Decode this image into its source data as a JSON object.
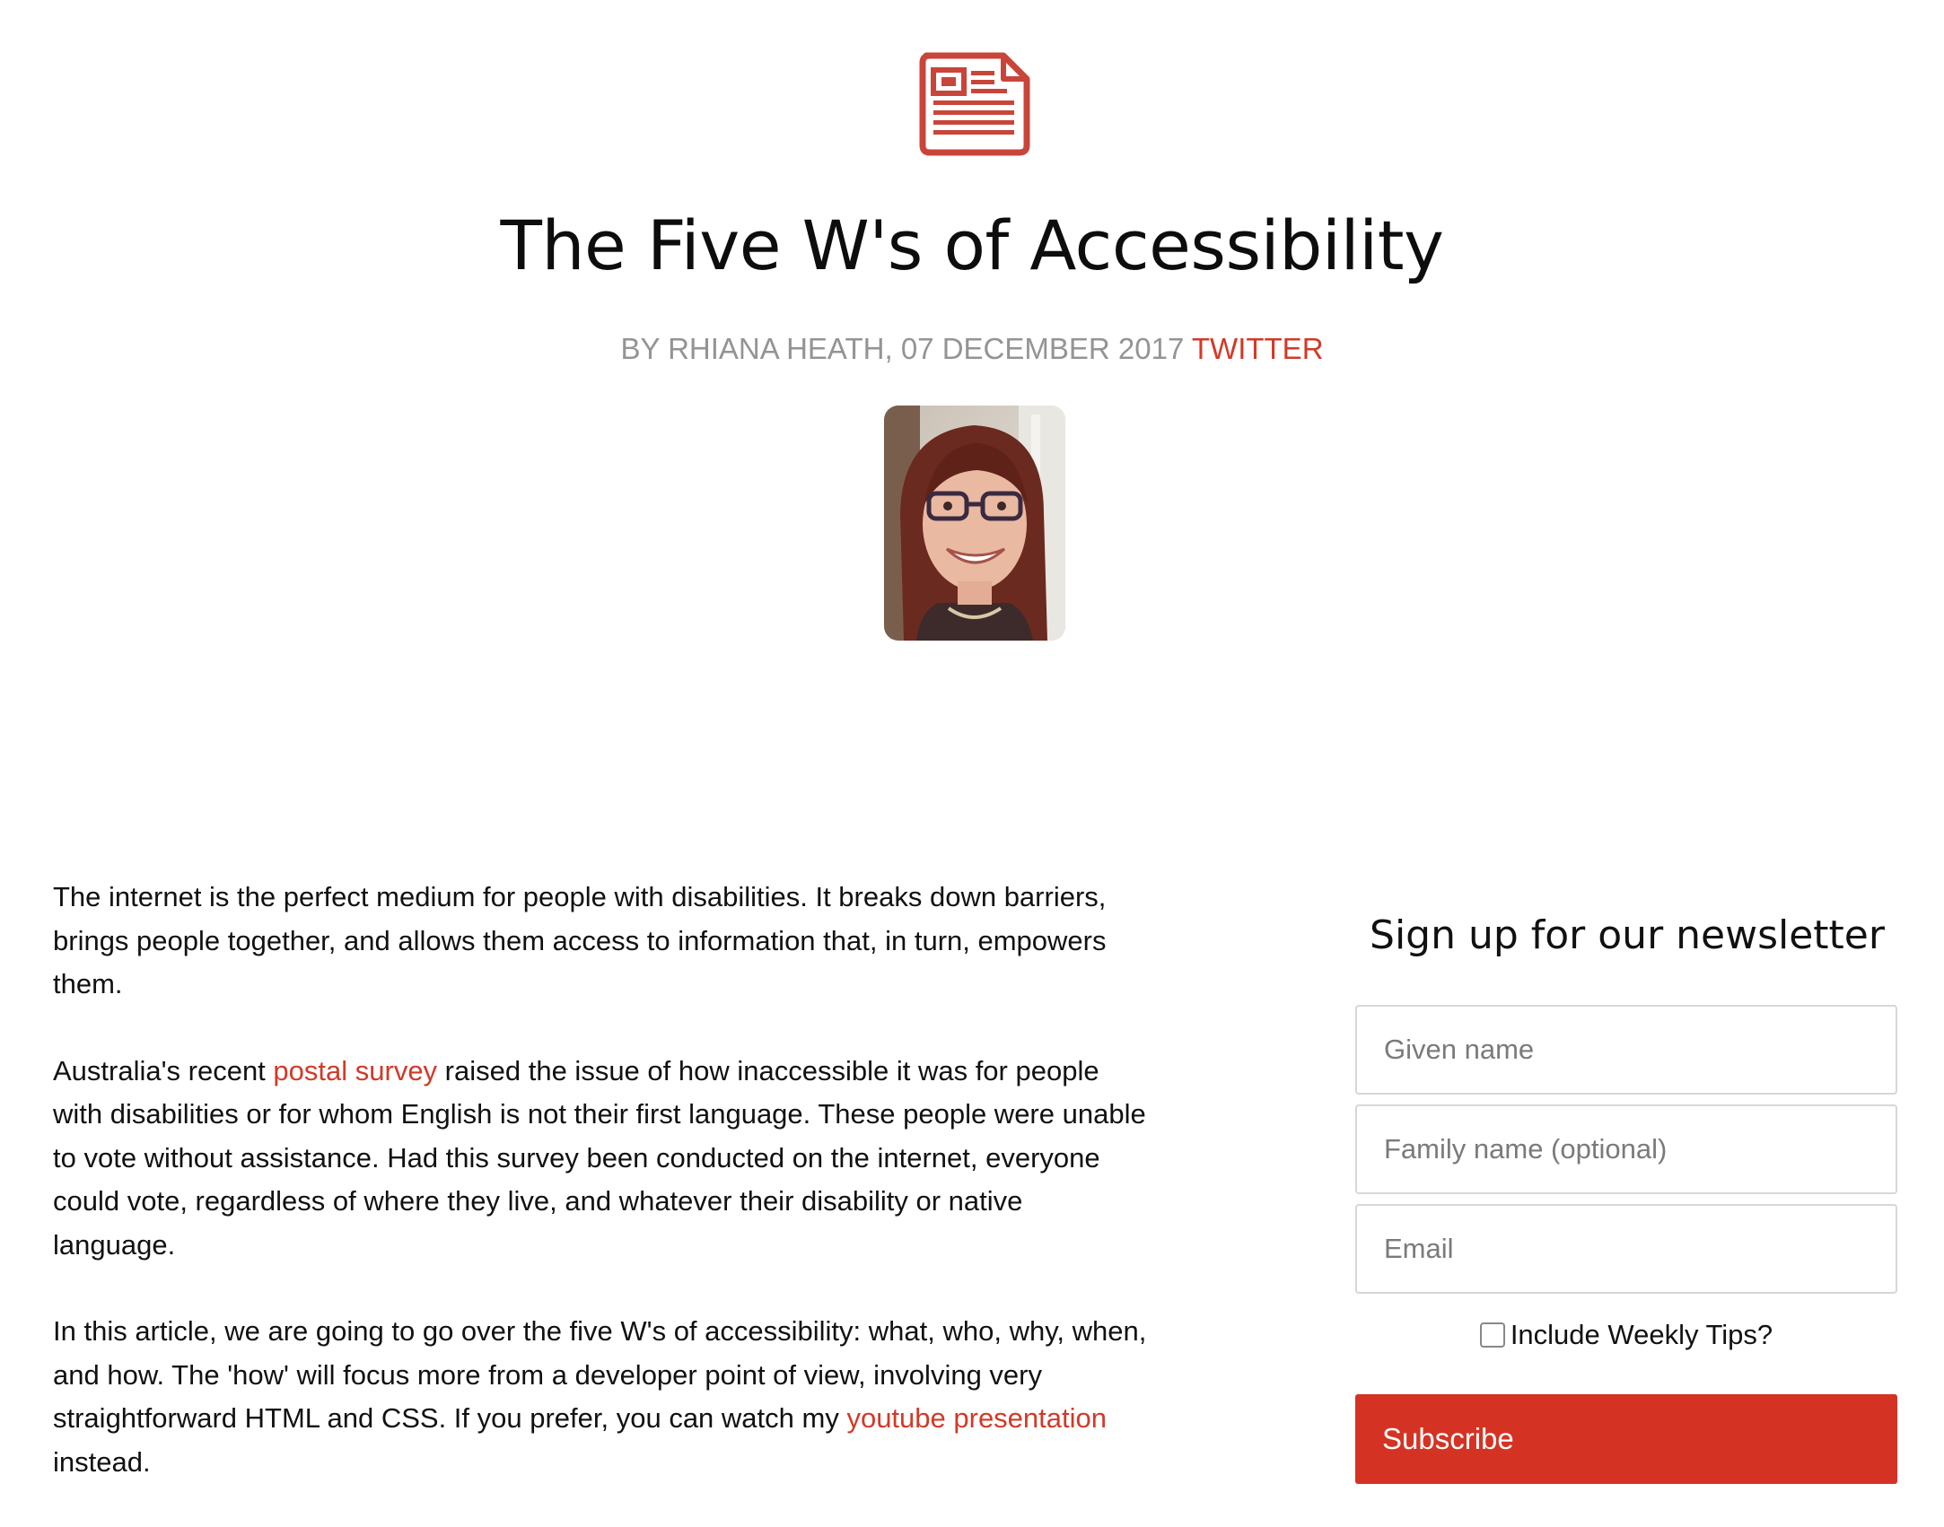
{
  "header": {
    "icon": "newspaper-icon",
    "title": "The Five W's of Accessibility",
    "byline_text": "BY RHIANA HEATH, 07 DECEMBER 2017",
    "byline_link": "TWITTER",
    "accent_color": "#d13a27"
  },
  "article": {
    "paragraphs": [
      {
        "text": "The internet is the perfect medium for people with disabilities. It breaks down barriers, brings people together, and allows them access to information that, in turn, empowers them."
      },
      {
        "before": "Australia's recent ",
        "link": "postal survey",
        "after": " raised the issue of how inaccessible it was for people with disabilities or for whom English is not their first language. These people were unable to vote without assistance. Had this survey been conducted on the internet, everyone could vote, regardless of where they live, and whatever their disability or native language."
      },
      {
        "before": "In this article, we are going to go over the five W's of accessibility: what, who, why, when, and how. The 'how' will focus more from a developer point of view, involving very straightforward HTML and CSS. If you prefer, you can watch my ",
        "link": "youtube presentation",
        "after": " instead."
      }
    ]
  },
  "newsletter": {
    "heading": "Sign up for our newsletter",
    "given_name_placeholder": "Given name",
    "family_name_placeholder": "Family name (optional)",
    "email_placeholder": "Email",
    "tips_label": "Include Weekly Tips?",
    "subscribe_label": "Subscribe",
    "button_color": "#d43323"
  }
}
